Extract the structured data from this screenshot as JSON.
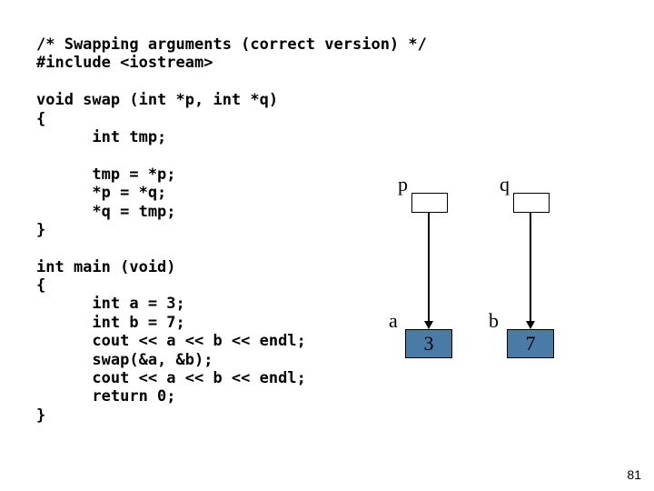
{
  "code": "/* Swapping arguments (correct version) */\n#include <iostream>\n\nvoid swap (int *p, int *q)\n{\n      int tmp;\n\n      tmp = *p;\n      *p = *q;\n      *q = tmp;\n}\n\nint main (void)\n{\n      int a = 3;\n      int b = 7;\n      cout << a << b << endl;\n      swap(&a, &b);\n      cout << a << b << endl;\n      return 0;\n}",
  "diagram": {
    "pointers": [
      {
        "label": "p"
      },
      {
        "label": "q"
      }
    ],
    "vars": [
      {
        "name": "a",
        "value": "3"
      },
      {
        "name": "b",
        "value": "7"
      }
    ]
  },
  "page_number": "81"
}
